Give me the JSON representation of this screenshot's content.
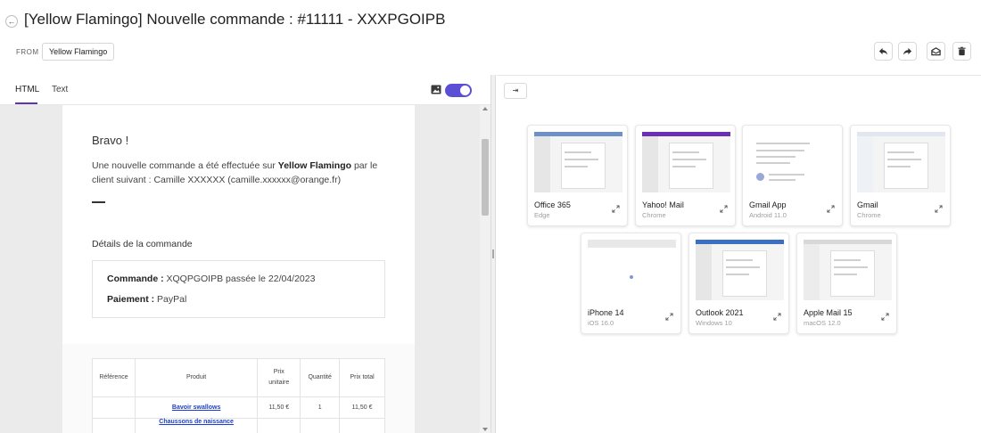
{
  "header": {
    "title": "[Yellow Flamingo] Nouvelle commande : #11111 - XXXPGOIPB",
    "back_icon": "←",
    "from_label": "FROM",
    "from_value": "Yellow Flamingo",
    "actions": [
      "reply-icon",
      "forward-icon",
      "mark-read-icon",
      "delete-icon"
    ]
  },
  "tabs": {
    "html": "HTML",
    "text": "Text"
  },
  "accent_color": "#5b4fd6",
  "email": {
    "greeting": "Bravo !",
    "intro_prefix": "Une nouvelle commande a été effectuée sur ",
    "shop_name": "Yellow Flamingo",
    "intro_middle": " par le client suivant : Camille XXXXXX (camille.xxxxxx@orange.fr)",
    "details_heading": "Détails de la commande",
    "order_label": "Commande :",
    "order_value": " XQQPGOIPB passée le 22/04/2023",
    "payment_label": "Paiement :",
    "payment_value": " PayPal",
    "table_headers": [
      "Référence",
      "Produit",
      "Prix unitaire",
      "Quantité",
      "Prix total"
    ],
    "rows": [
      {
        "ref": "",
        "product": "Bavoir swallows",
        "unit_price": "11,50 €",
        "qty": "1",
        "total": "11,50 €"
      },
      {
        "ref": "",
        "product": "Chaussons de naissance",
        "unit_price": "",
        "qty": "",
        "total": ""
      }
    ]
  },
  "right_panel": {
    "collapse_icon": "⇥",
    "clients": [
      {
        "name": "Office 365",
        "platform": "Edge"
      },
      {
        "name": "Yahoo! Mail",
        "platform": "Chrome"
      },
      {
        "name": "Gmail App",
        "platform": "Android 11.0"
      },
      {
        "name": "Gmail",
        "platform": "Chrome"
      },
      {
        "name": "iPhone 14",
        "platform": "iOS 16.0"
      },
      {
        "name": "Outlook 2021",
        "platform": "Windows 10"
      },
      {
        "name": "Apple Mail 15",
        "platform": "macOS 12.0"
      }
    ]
  }
}
